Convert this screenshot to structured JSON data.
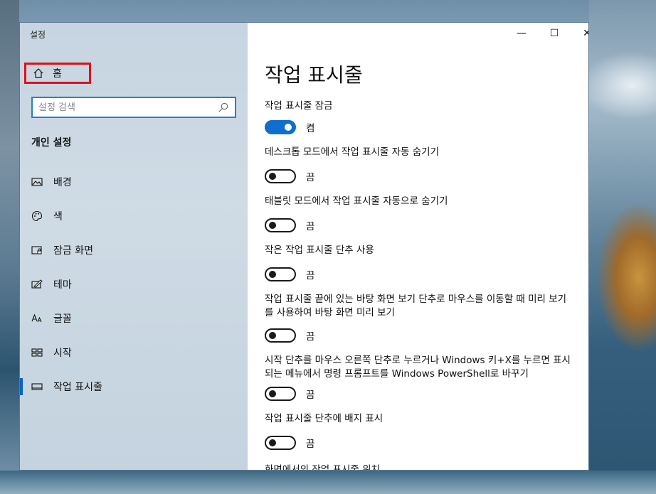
{
  "window": {
    "app_title": "설정",
    "controls": {
      "minimize": "—",
      "maximize": "☐",
      "close": "✕"
    }
  },
  "sidebar": {
    "home_label": "홈",
    "search": {
      "placeholder": "설정 검색"
    },
    "section_title": "개인 설정",
    "items": [
      {
        "label": "배경",
        "icon": "picture-icon",
        "active": false
      },
      {
        "label": "색",
        "icon": "palette-icon",
        "active": false
      },
      {
        "label": "잠금 화면",
        "icon": "lock-screen-icon",
        "active": false
      },
      {
        "label": "테마",
        "icon": "theme-icon",
        "active": false
      },
      {
        "label": "글꼴",
        "icon": "font-icon",
        "active": false
      },
      {
        "label": "시작",
        "icon": "start-icon",
        "active": false
      },
      {
        "label": "작업 표시줄",
        "icon": "taskbar-icon",
        "active": true
      }
    ]
  },
  "main": {
    "title": "작업 표시줄",
    "settings": [
      {
        "desc": "작업 표시줄 잠금",
        "state": "켬",
        "on": true
      },
      {
        "desc": "데스크톱 모드에서 작업 표시줄 자동 숨기기",
        "state": "끔",
        "on": false
      },
      {
        "desc": "태블릿 모드에서 작업 표시줄 자동으로 숨기기",
        "state": "끔",
        "on": false
      },
      {
        "desc": "작은 작업 표시줄 단추 사용",
        "state": "끔",
        "on": false
      },
      {
        "desc": "작업 표시줄 끝에 있는 바탕 화면 보기 단추로 마우스를 이동할 때 미리 보기를 사용하여 바탕 화면 미리 보기",
        "state": "끔",
        "on": false
      },
      {
        "desc": "시작 단추를 마우스 오른쪽 단추로 누르거나 Windows 키+X를 누르면 표시되는 메뉴에서 명령 프롬프트를 Windows PowerShell로 바꾸기",
        "state": "끔",
        "on": false
      },
      {
        "desc": "작업 표시줄 단추에 배지 표시",
        "state": "끔",
        "on": false
      }
    ],
    "next_heading": "화면에서의 작업 표시줄 위치"
  },
  "colors": {
    "accent": "#0e6fd0",
    "highlight_box": "#e0101a",
    "sidebar_bg": "#c9d7e2"
  }
}
